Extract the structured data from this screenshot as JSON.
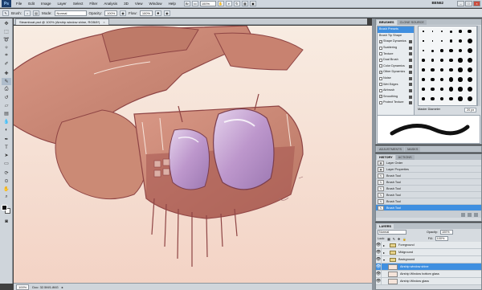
{
  "menubar": {
    "app": "Ps",
    "items": [
      "File",
      "Edit",
      "Image",
      "Layer",
      "Select",
      "Filter",
      "Analysis",
      "3D",
      "View",
      "Window",
      "Help"
    ],
    "zoom": "100%",
    "workspace": "BEN62"
  },
  "options": {
    "brush_label": "Brush:",
    "mode_label": "Mode:",
    "mode_value": "Normal",
    "opacity_label": "Opacity:",
    "opacity_value": "100%",
    "flow_label": "Flow:",
    "flow_value": "100%"
  },
  "document": {
    "tab_title": "Steamboat.psd @ 100% (Airship window shine, RGB/8*)",
    "zoom": "100%",
    "status": "Doc: 32.5M/1.86G"
  },
  "brushes_panel": {
    "tabs": [
      "BRUSHES",
      "CLONE SOURCE"
    ],
    "options": [
      {
        "label": "Brush Presets",
        "checked": false,
        "selected": true
      },
      {
        "label": "Brush Tip Shape",
        "checked": false
      },
      {
        "label": "Shape Dynamics",
        "checked": true
      },
      {
        "label": "Scattering",
        "checked": false
      },
      {
        "label": "Texture",
        "checked": false
      },
      {
        "label": "Dual Brush",
        "checked": false
      },
      {
        "label": "Color Dynamics",
        "checked": false
      },
      {
        "label": "Other Dynamics",
        "checked": true
      },
      {
        "label": "Noise",
        "checked": false
      },
      {
        "label": "Wet Edges",
        "checked": false
      },
      {
        "label": "Airbrush",
        "checked": false
      },
      {
        "label": "Smoothing",
        "checked": true
      },
      {
        "label": "Protect Texture",
        "checked": false
      }
    ],
    "master_label": "Master Diameter",
    "master_value": "20 px"
  },
  "adjust_tabs": [
    "ADJUSTMENTS",
    "MASKS"
  ],
  "history_panel": {
    "tabs": [
      "HISTORY",
      "ACTIONS"
    ],
    "items": [
      {
        "label": "Layer Order",
        "icon": "layers-icon"
      },
      {
        "label": "Layer Properties",
        "icon": "layers-icon"
      },
      {
        "label": "Brush Tool",
        "icon": "brush-icon"
      },
      {
        "label": "Brush Tool",
        "icon": "brush-icon"
      },
      {
        "label": "Brush Tool",
        "icon": "brush-icon"
      },
      {
        "label": "Brush Tool",
        "icon": "brush-icon"
      },
      {
        "label": "Brush Tool",
        "icon": "brush-icon"
      },
      {
        "label": "Brush Tool",
        "icon": "brush-icon",
        "active": true
      }
    ]
  },
  "layers_panel": {
    "tabs": [
      "LAYERS"
    ],
    "blend_mode": "Normal",
    "opacity_label": "Opacity:",
    "opacity_value": "100%",
    "lock_label": "Lock:",
    "fill_label": "Fill:",
    "fill_value": "100%",
    "layers": [
      {
        "name": "Foreground",
        "type": "group",
        "visible": true
      },
      {
        "name": "Midground",
        "type": "group",
        "visible": true
      },
      {
        "name": "Background",
        "type": "group",
        "visible": true,
        "expanded": true
      },
      {
        "name": "Airship window shine",
        "type": "layer",
        "visible": true,
        "selected": true
      },
      {
        "name": "Airship Window bottom glass",
        "type": "layer",
        "visible": true
      },
      {
        "name": "Airship Window glass",
        "type": "layer",
        "visible": true
      }
    ]
  },
  "colors": {
    "canvas_bg": "#f6e3d8",
    "ship_body": "#c9836f",
    "ship_dark": "#9d4f49",
    "window_glass": "#b893c8",
    "selection_blue": "#3f8fe0"
  }
}
